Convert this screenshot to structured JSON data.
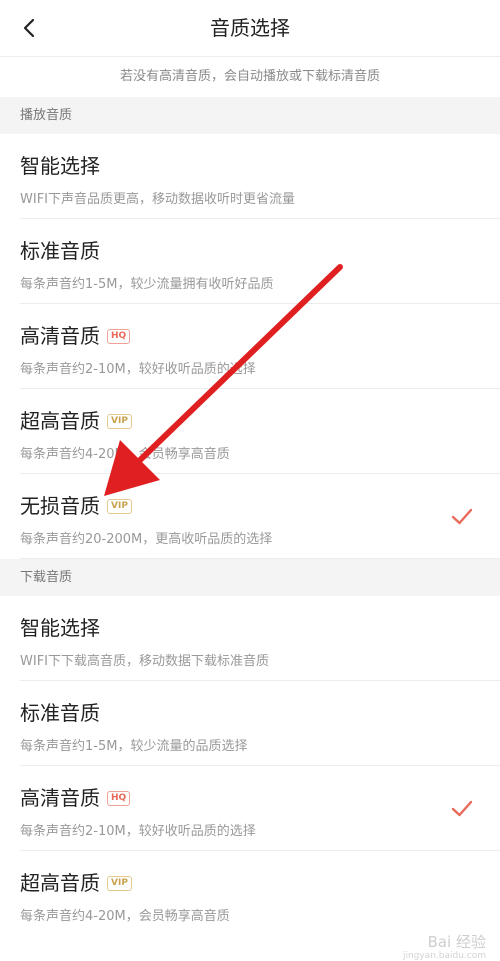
{
  "header": {
    "title": "音质选择",
    "back_icon": "chevron-left-icon"
  },
  "notice": "若没有高清音质，会自动播放或下载标清音质",
  "colors": {
    "accent": "#e96a5a",
    "vip": "#c9a24e",
    "arrow": "#e02020"
  },
  "play_section": {
    "label": "播放音质",
    "items": [
      {
        "name": "智能选择",
        "badge": "",
        "desc": "WIFI下声音品质更高，移动数据收听时更省流量",
        "selected": false
      },
      {
        "name": "标准音质",
        "badge": "",
        "desc": "每条声音约1-5M，较少流量拥有收听好品质",
        "selected": false
      },
      {
        "name": "高清音质",
        "badge": "HQ",
        "desc": "每条声音约2-10M，较好收听品质的选择",
        "selected": false
      },
      {
        "name": "超高音质",
        "badge": "VIP",
        "desc": "每条声音约4-20M，会员畅享高音质",
        "selected": false
      },
      {
        "name": "无损音质",
        "badge": "VIP",
        "desc": "每条声音约20-200M，更高收听品质的选择",
        "selected": true
      }
    ]
  },
  "download_section": {
    "label": "下载音质",
    "items": [
      {
        "name": "智能选择",
        "badge": "",
        "desc": "WIFI下下载高音质，移动数据下载标准音质",
        "selected": false
      },
      {
        "name": "标准音质",
        "badge": "",
        "desc": "每条声音约1-5M，较少流量的品质选择",
        "selected": false
      },
      {
        "name": "高清音质",
        "badge": "HQ",
        "desc": "每条声音约2-10M，较好收听品质的选择",
        "selected": true
      },
      {
        "name": "超高音质",
        "badge": "VIP",
        "desc": "每条声音约4-20M，会员畅享高音质",
        "selected": false
      }
    ]
  },
  "watermark": {
    "text": "Bai 经验",
    "sub": "jingyan.baidu.com"
  }
}
